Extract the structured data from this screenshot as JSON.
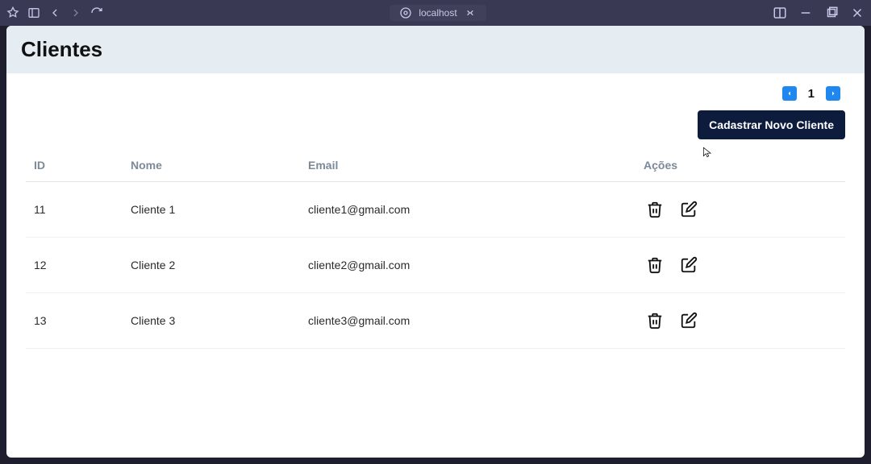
{
  "browser": {
    "url_label": "localhost"
  },
  "header": {
    "title": "Clientes"
  },
  "pager": {
    "current_page": "1"
  },
  "toolbar": {
    "new_client_label": "Cadastrar Novo Cliente"
  },
  "table": {
    "headers": {
      "id": "ID",
      "nome": "Nome",
      "email": "Email",
      "acoes": "Ações"
    },
    "rows": [
      {
        "id": "11",
        "nome": "Cliente 1",
        "email": "cliente1@gmail.com"
      },
      {
        "id": "12",
        "nome": "Cliente 2",
        "email": "cliente2@gmail.com"
      },
      {
        "id": "13",
        "nome": "Cliente 3",
        "email": "cliente3@gmail.com"
      }
    ]
  }
}
